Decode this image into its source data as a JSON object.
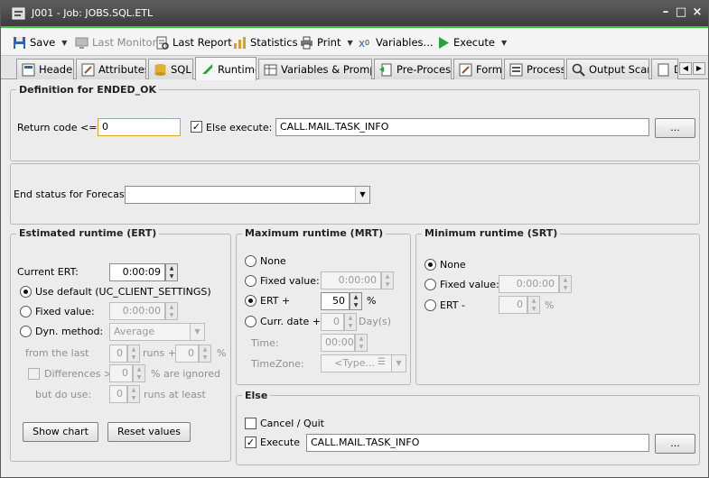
{
  "window": {
    "title": "J001 - Job: JOBS.SQL.ETL",
    "minimize": "–",
    "maximize": "□",
    "close": "×"
  },
  "toolbar": {
    "save": "Save",
    "last_monitor": "Last Monitor",
    "last_report": "Last Report",
    "statistics": "Statistics",
    "print": "Print",
    "variables": "Variables...",
    "execute": "Execute"
  },
  "tabs": [
    "Header",
    "Attributes",
    "SQL",
    "Runtime",
    "Variables & Prompts",
    "Pre-Process",
    "Form",
    "Process",
    "Output Scan",
    "D"
  ],
  "tab_scroll": {
    "left": "◀",
    "right": "▶"
  },
  "ended_ok": {
    "legend": "Definition for ENDED_OK",
    "return_code_label": "Return code <=:",
    "return_code_value": "0",
    "else_execute_label": "Else execute:",
    "else_execute_value": "CALL.MAIL.TASK_INFO",
    "browse": "..."
  },
  "forecast": {
    "label": "End status for Forecast:",
    "value": ""
  },
  "ert": {
    "legend": "Estimated runtime (ERT)",
    "current_label": "Current ERT:",
    "current_value": "0:00:09",
    "use_default": "Use default (UC_CLIENT_SETTINGS)",
    "fixed_label": "Fixed value:",
    "fixed_value": "0:00:00",
    "dyn_label": "Dyn. method:",
    "dyn_value": "Average",
    "from_last": "from the last",
    "from_last_value": "0",
    "runs_plus": "runs +",
    "runs_plus_value": "0",
    "percent": "%",
    "differences": "Differences >",
    "differences_value": "0",
    "ignored": "% are ignored",
    "but_do_use": "but do use:",
    "but_do_use_value": "0",
    "runs_at_least": "runs at least",
    "show_chart": "Show chart",
    "reset_values": "Reset values"
  },
  "mrt": {
    "legend": "Maximum runtime (MRT)",
    "none": "None",
    "fixed_label": "Fixed value:",
    "fixed_value": "0:00:00",
    "ert_plus": "ERT +",
    "ert_plus_value": "50",
    "percent": "%",
    "curr_date": "Curr. date +",
    "curr_date_value": "0",
    "days": "Day(s)",
    "time_label": "Time:",
    "time_value": "00:00",
    "timezone_label": "TimeZone:",
    "timezone_placeholder": "<Type..."
  },
  "srt": {
    "legend": "Minimum runtime (SRT)",
    "none": "None",
    "fixed_label": "Fixed value:",
    "fixed_value": "0:00:00",
    "ert_minus": "ERT -",
    "ert_minus_value": "0",
    "percent": "%"
  },
  "else_panel": {
    "legend": "Else",
    "cancel_quit": "Cancel / Quit",
    "execute_label": "Execute",
    "execute_value": "CALL.MAIL.TASK_INFO",
    "browse": "..."
  },
  "colors": {
    "titlebar": "#4a4a4a",
    "accent": "#39c739",
    "panel": "#ececec"
  }
}
